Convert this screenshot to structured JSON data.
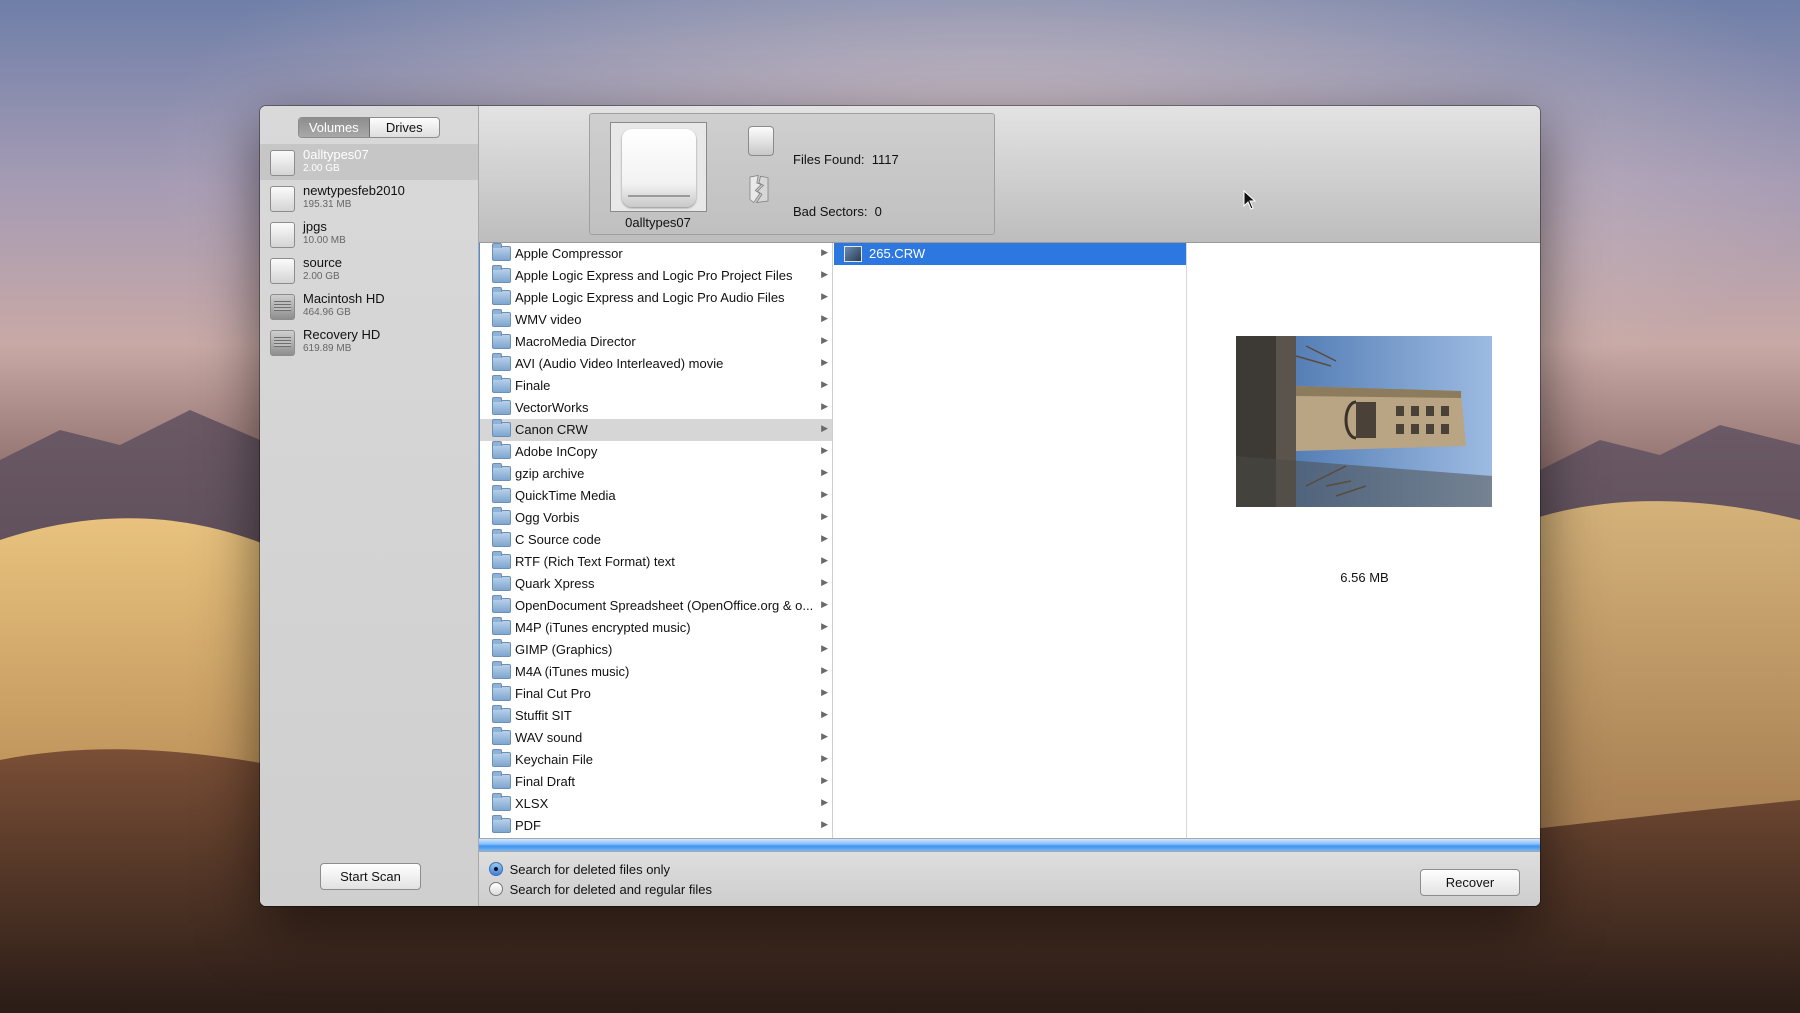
{
  "sidebar": {
    "tabs": [
      {
        "label": "Volumes",
        "active": true
      },
      {
        "label": "Drives",
        "active": false
      }
    ],
    "volumes": [
      {
        "name": "0alltypes07",
        "size": "2.00 GB",
        "kind": "removable",
        "selected": true
      },
      {
        "name": "newtypesfeb2010",
        "size": "195.31 MB",
        "kind": "removable",
        "selected": false
      },
      {
        "name": "jpgs",
        "size": "10.00 MB",
        "kind": "removable",
        "selected": false
      },
      {
        "name": "source",
        "size": "2.00 GB",
        "kind": "removable",
        "selected": false
      },
      {
        "name": "Macintosh HD",
        "size": "464.96 GB",
        "kind": "hard-disk",
        "selected": false
      },
      {
        "name": "Recovery HD",
        "size": "619.89 MB",
        "kind": "hard-disk",
        "selected": false
      }
    ],
    "start_scan_label": "Start Scan"
  },
  "summary": {
    "drive_name": "0alltypes07",
    "files_found_label": "Files Found:",
    "files_found_value": "1117",
    "bad_sectors_label": "Bad Sectors:",
    "bad_sectors_value": "0"
  },
  "browser": {
    "categories": [
      {
        "label": "Apple Compressor"
      },
      {
        "label": "Apple Logic Express and Logic Pro Project Files"
      },
      {
        "label": "Apple Logic Express and Logic Pro Audio Files"
      },
      {
        "label": "WMV video"
      },
      {
        "label": "MacroMedia Director"
      },
      {
        "label": "AVI (Audio Video Interleaved) movie"
      },
      {
        "label": "Finale"
      },
      {
        "label": "VectorWorks"
      },
      {
        "label": "Canon CRW",
        "highlighted": true
      },
      {
        "label": "Adobe InCopy"
      },
      {
        "label": "gzip archive"
      },
      {
        "label": "QuickTime Media"
      },
      {
        "label": "Ogg Vorbis"
      },
      {
        "label": "C Source code"
      },
      {
        "label": "RTF (Rich Text Format) text"
      },
      {
        "label": "Quark Xpress"
      },
      {
        "label": "OpenDocument Spreadsheet (OpenOffice.org & o..."
      },
      {
        "label": "M4P (iTunes encrypted music)"
      },
      {
        "label": "GIMP (Graphics)"
      },
      {
        "label": "M4A (iTunes music)"
      },
      {
        "label": "Final Cut Pro"
      },
      {
        "label": "Stuffit SIT"
      },
      {
        "label": "WAV sound"
      },
      {
        "label": "Keychain File"
      },
      {
        "label": "Final Draft"
      },
      {
        "label": "XLSX"
      },
      {
        "label": "PDF"
      }
    ],
    "files": [
      {
        "label": "265.CRW",
        "selected": true
      }
    ],
    "preview_size": "6.56 MB"
  },
  "progress": {
    "fraction": 1.0,
    "color": "#3f93ef"
  },
  "options": {
    "deleted_only_label": "Search for deleted files only",
    "deleted_and_regular_label": "Search for deleted and regular files",
    "selected": "deleted_only"
  },
  "recover_label": "Recover",
  "colors": {
    "selection": "#2d78e0",
    "accent": "#4a8de0"
  }
}
